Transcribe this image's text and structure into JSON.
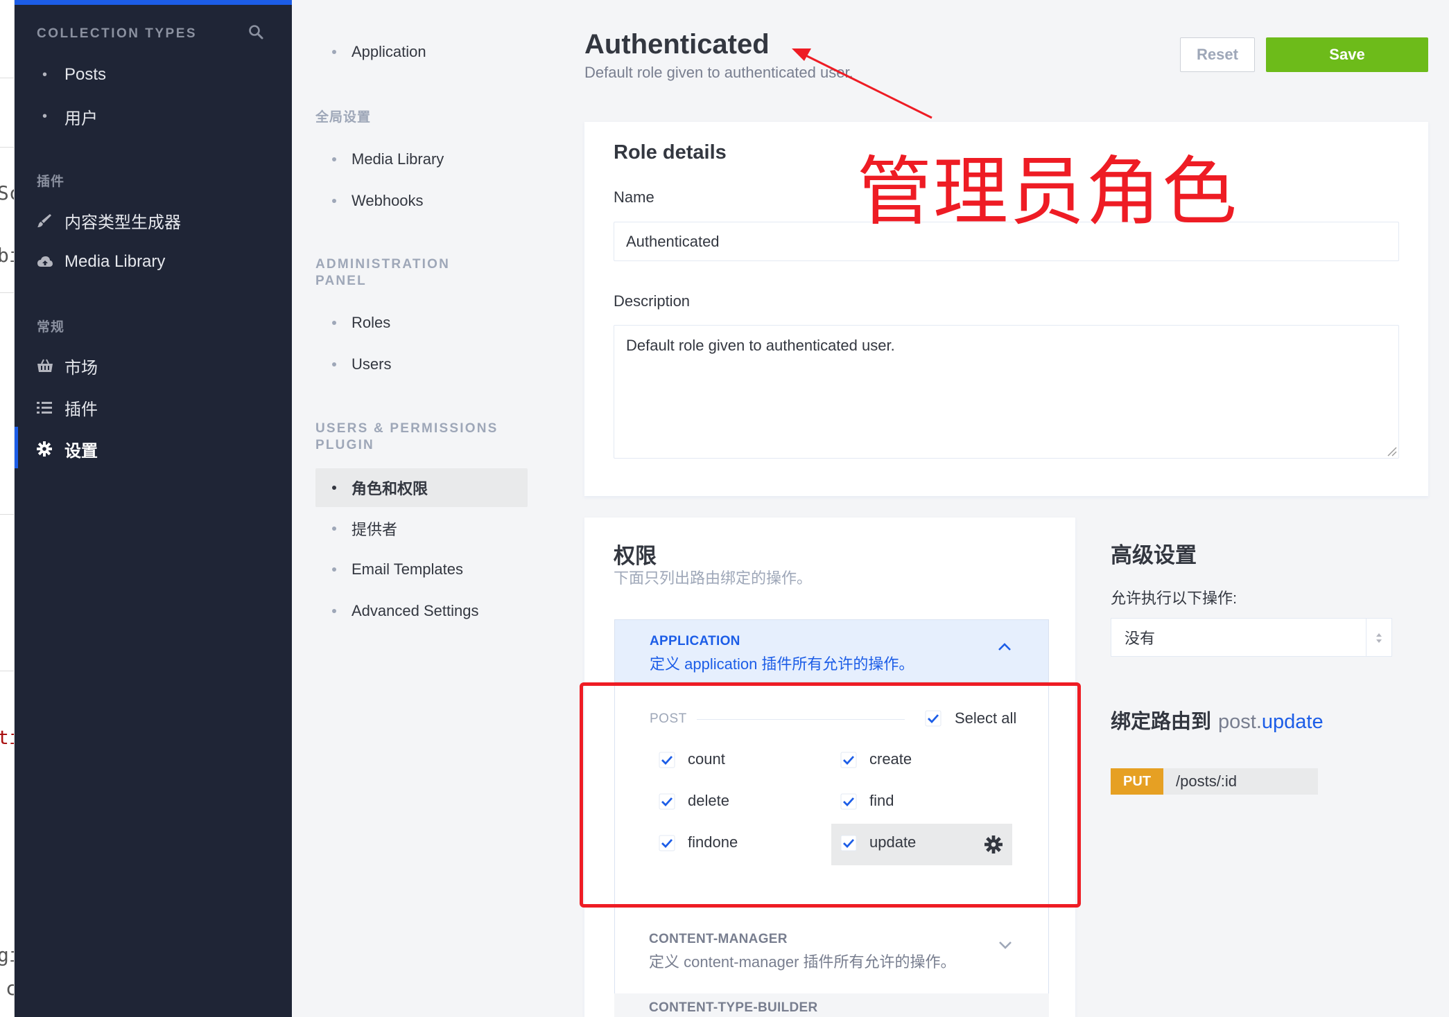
{
  "edge": {
    "fragments": [
      "Sc",
      "bi",
      "ti",
      "gi",
      "c"
    ]
  },
  "sidebar": {
    "collection_heading": "COLLECTION TYPES",
    "collection_items": [
      {
        "label": "Posts"
      },
      {
        "label": "用户"
      }
    ],
    "plugins_heading": "插件",
    "plugin_items": [
      {
        "label": "内容类型生成器",
        "icon": "brush-icon"
      },
      {
        "label": "Media Library",
        "icon": "cloud-upload-icon"
      }
    ],
    "general_heading": "常规",
    "general_items": [
      {
        "label": "市场",
        "icon": "basket-icon"
      },
      {
        "label": "插件",
        "icon": "list-icon"
      },
      {
        "label": "设置",
        "icon": "gear-icon",
        "active": true
      }
    ]
  },
  "settings_nav": {
    "application_item": "Application",
    "global_heading": "全局设置",
    "global_items": [
      "Media Library",
      "Webhooks"
    ],
    "admin_heading_line1": "ADMINISTRATION",
    "admin_heading_line2": "PANEL",
    "admin_items": [
      "Roles",
      "Users"
    ],
    "up_heading_line1": "USERS & PERMISSIONS",
    "up_heading_line2": "PLUGIN",
    "up_items": [
      "角色和权限",
      "提供者",
      "Email Templates",
      "Advanced Settings"
    ]
  },
  "header": {
    "title": "Authenticated",
    "subtitle": "Default role given to authenticated user.",
    "reset_label": "Reset",
    "save_label": "Save"
  },
  "role_details": {
    "title": "Role details",
    "name_label": "Name",
    "name_value": "Authenticated",
    "description_label": "Description",
    "description_value": "Default role given to authenticated user."
  },
  "permissions": {
    "title": "权限",
    "subtitle": "下面只列出路由绑定的操作。",
    "application": {
      "name": "APPLICATION",
      "description": "定义 application 插件所有允许的操作。",
      "group": "POST",
      "select_all_label": "Select all",
      "actions": [
        "count",
        "create",
        "delete",
        "find",
        "findone",
        "update"
      ]
    },
    "content_manager": {
      "name": "CONTENT-MANAGER",
      "description": "定义 content-manager 插件所有允许的操作。"
    },
    "content_type_builder": {
      "name": "CONTENT-TYPE-BUILDER"
    }
  },
  "advanced": {
    "title": "高级设置",
    "allow_label": "允许执行以下操作:",
    "select_value": "没有",
    "route_title": "绑定路由到",
    "route_model": "post.",
    "route_action": "update",
    "route_verb": "PUT",
    "route_path": "/posts/:id"
  },
  "annotation": {
    "text": "管理员角色",
    "color": "#ee1c24"
  },
  "colors": {
    "primary": "#1c5de7",
    "save_green": "#6dbb1a",
    "put_orange": "#e6a023",
    "sidebar_bg": "#1f2536"
  }
}
